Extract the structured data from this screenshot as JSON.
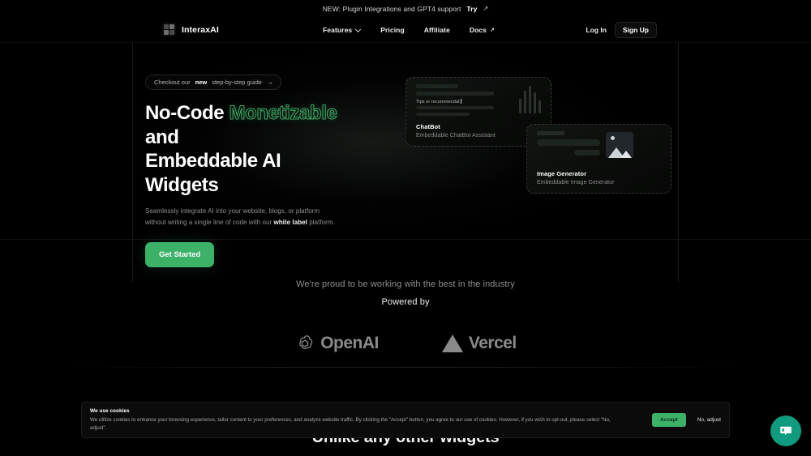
{
  "announcement": {
    "text": "NEW: Plugin Integrations and GPT4 support",
    "link_label": "Try",
    "link_icon": "external-link-arrow"
  },
  "nav": {
    "brand": "InteraxAI",
    "links": [
      {
        "label": "Features",
        "icon": "chevron-down-icon"
      },
      {
        "label": "Pricing",
        "icon": ""
      },
      {
        "label": "Affiliate",
        "icon": ""
      },
      {
        "label": "Docs",
        "icon": "external-link-arrow"
      }
    ],
    "login_label": "Log In",
    "signup_label": "Sign Up"
  },
  "hero": {
    "badge_prefix": "Checkout our",
    "badge_strong": "new",
    "badge_suffix": "step-by-step guide",
    "badge_arrow": "→",
    "headline_part1": "No-Code",
    "headline_highlight": "Monetizable",
    "headline_part2": "and",
    "headline_line2": "Embeddable AI Widgets",
    "sub_part1": "Seamlessly integrate AI into your website, blogs, or platform without writing a single line of code with our",
    "sub_strong": "white label",
    "sub_part2": "platform.",
    "cta_label": "Get Started",
    "accent_color": "#3bb268",
    "highlight_color": "#3fa866",
    "cards": [
      {
        "title": "ChatBot",
        "subtitle": "Embeddable ChatBot Assistant",
        "typed_text": "Tips or recommendat"
      },
      {
        "title": "Image Generator",
        "subtitle": "Embeddable Image Generator",
        "typed_text": ""
      }
    ]
  },
  "partners": {
    "tagline": "We're proud to be working with the best in the industry",
    "powered_by": "Powered by",
    "logos": [
      {
        "name": "OpenAI",
        "icon": "openai-logo-icon"
      },
      {
        "name": "Vercel",
        "icon": "vercel-triangle-icon"
      }
    ]
  },
  "bottom_section": {
    "heading": "Unlike any other widgets"
  },
  "cookie_banner": {
    "title": "We use cookies",
    "body": "We utilize cookies to enhance your browsing experience, tailor content to your preferences, and analyze website traffic. By clicking the \"Accept\" button, you agree to our use of cookies. However, if you wish to opt-out, please select \"No, adjust\".",
    "accept_label": "Accept",
    "decline_label": "No, adjust"
  },
  "chat_widget": {
    "icon": "chat-bubble-icon",
    "color": "#0f9b7e"
  }
}
